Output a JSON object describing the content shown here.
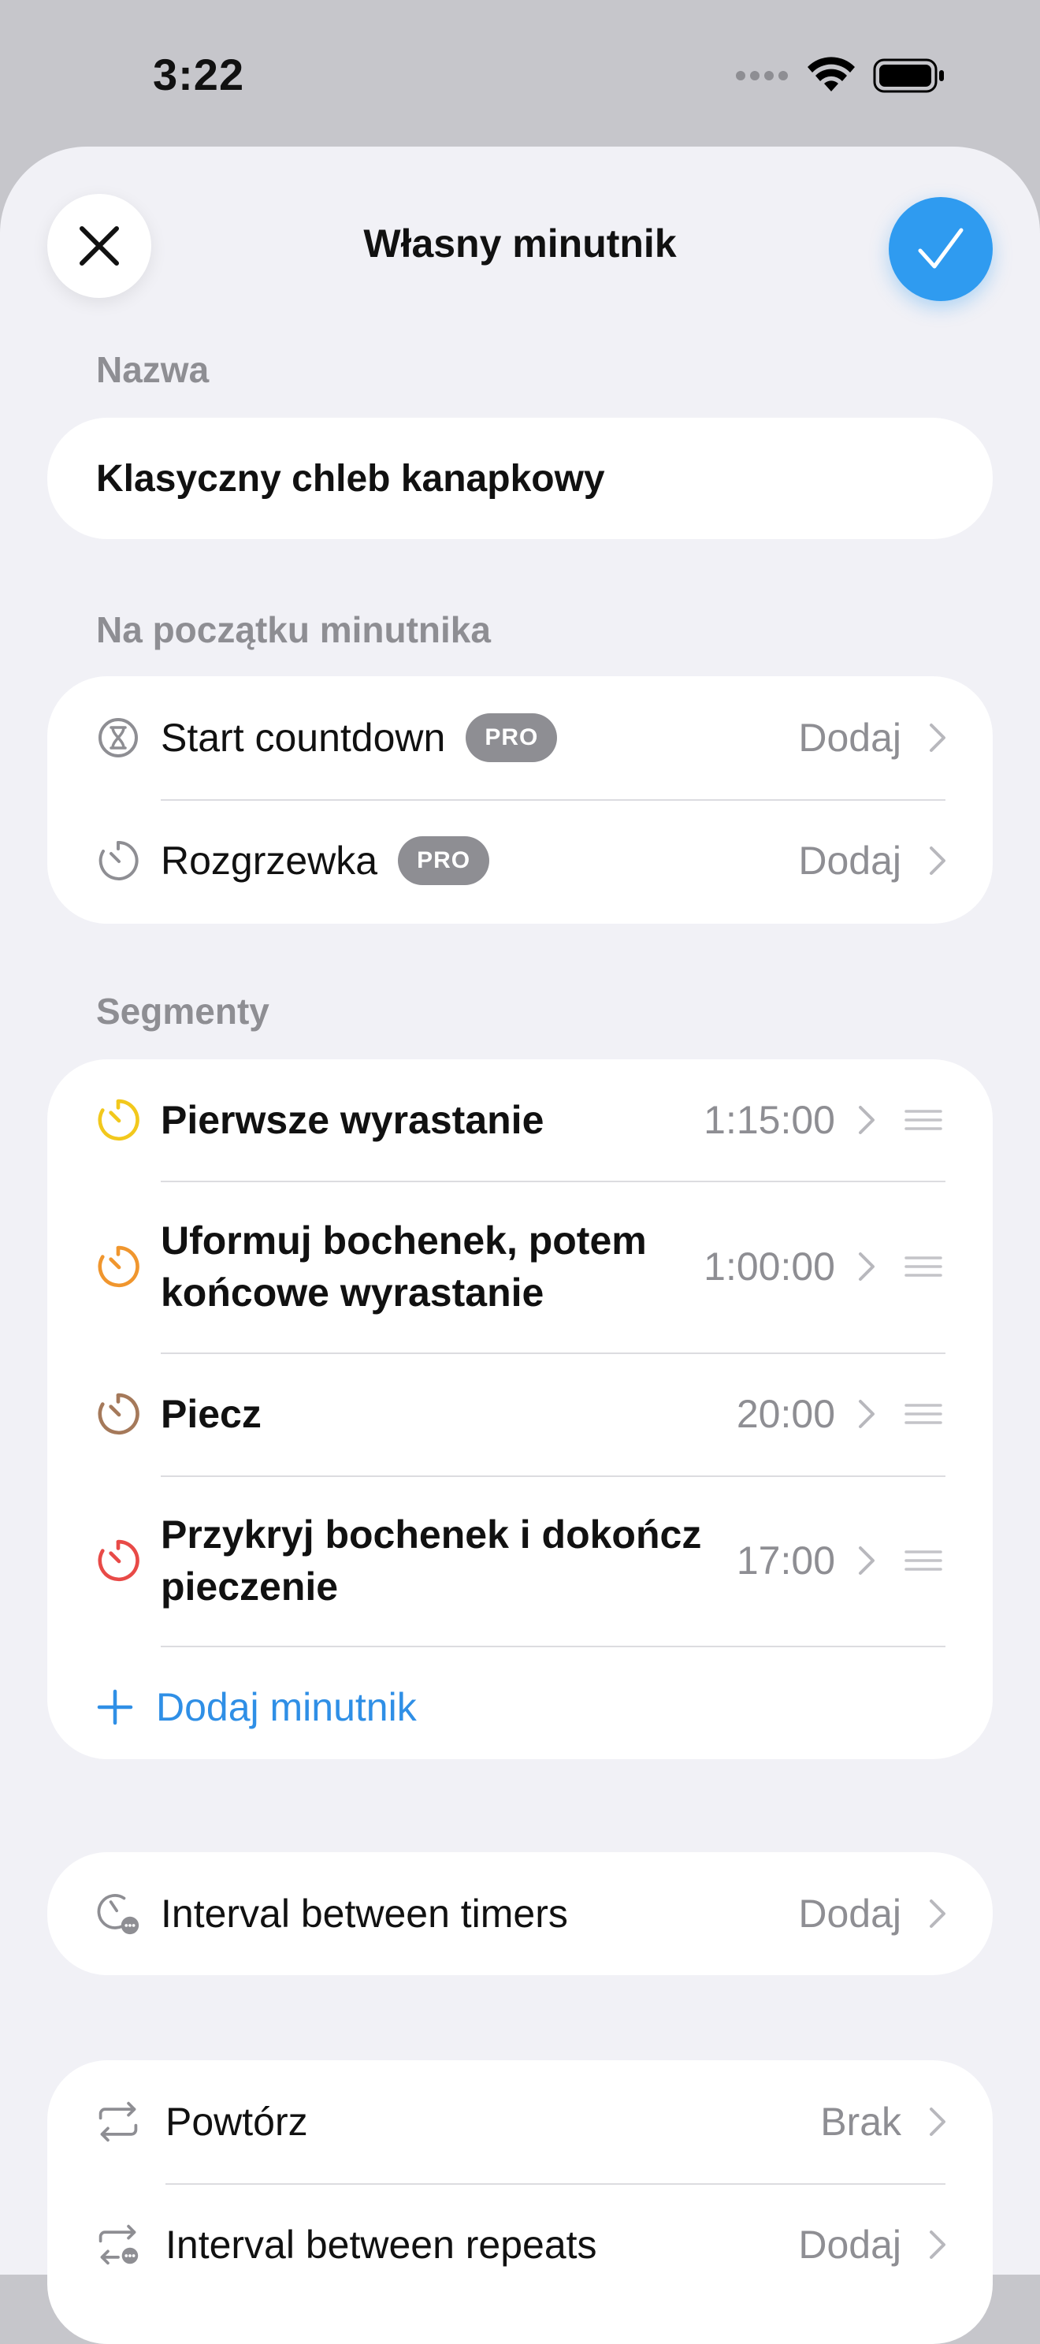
{
  "status_bar": {
    "time": "3:22"
  },
  "header": {
    "title": "Własny minutnik"
  },
  "name_section": {
    "label": "Nazwa",
    "value": "Klasyczny chleb kanapkowy"
  },
  "start_section": {
    "label": "Na początku minutnika",
    "rows": [
      {
        "label": "Start countdown",
        "badge": "PRO",
        "value": "Dodaj",
        "icon": "hourglass-icon"
      },
      {
        "label": "Rozgrzewka",
        "badge": "PRO",
        "value": "Dodaj",
        "icon": "timer-icon"
      }
    ]
  },
  "segments_section": {
    "label": "Segmenty",
    "items": [
      {
        "label": "Pierwsze wyrastanie",
        "value": "1:15:00",
        "color": "#f2c81c"
      },
      {
        "label": "Uformuj bochenek, potem końcowe wyrastanie",
        "value": "1:00:00",
        "color": "#f0962e"
      },
      {
        "label": "Piecz",
        "value": "20:00",
        "color": "#a5795a"
      },
      {
        "label": "Przykryj bochenek i dokończ pieczenie",
        "value": "17:00",
        "color": "#e84a47"
      }
    ],
    "add_label": "Dodaj minutnik"
  },
  "interval_section": {
    "label": "Interval between timers",
    "value": "Dodaj"
  },
  "repeat_section": {
    "rows": [
      {
        "label": "Powtórz",
        "value": "Brak"
      },
      {
        "label": "Interval between repeats",
        "value": "Dodaj"
      }
    ]
  },
  "colors": {
    "accent": "#2f9bf0",
    "link": "#2f8fe6",
    "badge": "#8e8e93",
    "secondary_text": "#8e8e93"
  }
}
